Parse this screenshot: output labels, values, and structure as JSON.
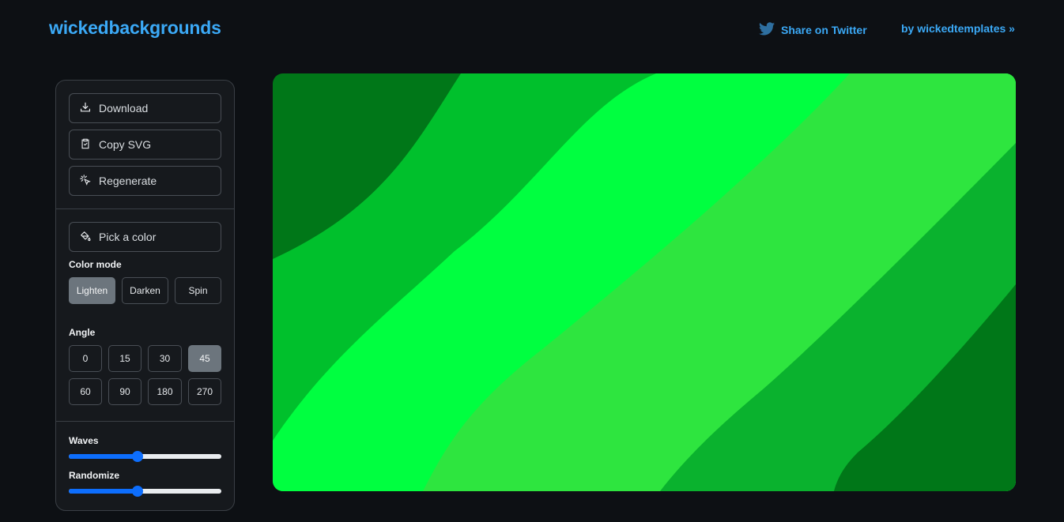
{
  "header": {
    "logo": "wickedbackgrounds",
    "share_label": "Share on Twitter",
    "by_label": "by wickedtemplates »",
    "accent": "#3ba9f6"
  },
  "actions": {
    "download": "Download",
    "copy_svg": "Copy SVG",
    "regenerate": "Regenerate"
  },
  "color": {
    "pick_label": "Pick a color",
    "mode_label": "Color mode",
    "modes": [
      "Lighten",
      "Darken",
      "Spin"
    ],
    "selected_mode": "Lighten",
    "base_color": "#00ff40"
  },
  "angle": {
    "label": "Angle",
    "options": [
      "0",
      "15",
      "30",
      "45",
      "60",
      "90",
      "180",
      "270"
    ],
    "selected": "45"
  },
  "sliders": {
    "waves": {
      "label": "Waves",
      "value": 0.45
    },
    "randomize": {
      "label": "Randomize",
      "value": 0.45
    }
  },
  "preview": {
    "colors": [
      "#007718",
      "#00c02c",
      "#00ff40",
      "#2ee53f",
      "#0ab22e",
      "#007718"
    ]
  }
}
